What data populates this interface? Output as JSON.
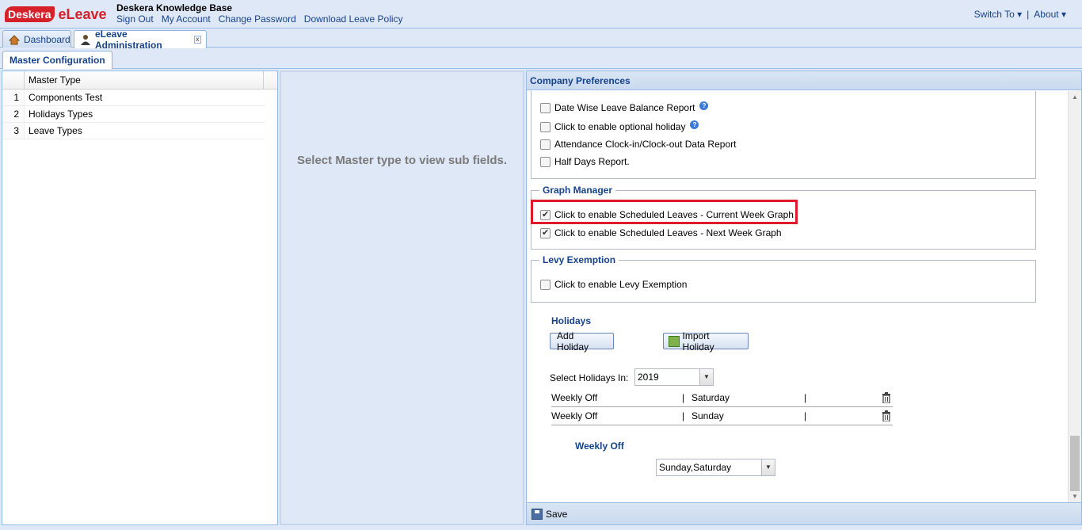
{
  "header": {
    "logo_badge": "Deskera",
    "logo_app": "eLeave",
    "site_title": "Desk​era Knowledge Base",
    "links": [
      "Sign Out",
      "My Account",
      "Change Password",
      "Download Leave Policy"
    ],
    "switch_to": "Switch To",
    "about": "About",
    "separator": "|"
  },
  "tabs": {
    "dashboard": "Dashboard",
    "admin": "eLeave Administration",
    "close": "x"
  },
  "subtab": {
    "label": "Master Configuration"
  },
  "grid": {
    "header": "Master Type",
    "rows": [
      {
        "num": "1",
        "label": "Components Test"
      },
      {
        "num": "2",
        "label": "Holidays Types"
      },
      {
        "num": "3",
        "label": "Leave Types"
      }
    ]
  },
  "middle": {
    "message": "Select Master type to view sub fields."
  },
  "company_prefs": {
    "title": "Company Preferences",
    "report_items": [
      {
        "label": "Date Wise Leave Balance Report",
        "checked": false,
        "help": true
      },
      {
        "label": "Click to enable optional holiday",
        "checked": false,
        "help": true
      },
      {
        "label": "Attendance Clock-in/Clock-out Data Report",
        "checked": false,
        "help": false
      },
      {
        "label": "Half Days Report.",
        "checked": false,
        "help": false
      }
    ],
    "graph_manager": {
      "legend": "Graph Manager",
      "current_week": "Click to enable Scheduled Leaves - Current Week Graph",
      "next_week": "Click to enable Scheduled Leaves - Next Week Graph"
    },
    "levy": {
      "legend": "Levy Exemption",
      "label": "Click to enable Levy Exemption"
    },
    "holidays": {
      "title": "Holidays",
      "add_button": "Add Holiday",
      "import_button": "Import Holiday",
      "select_label": "Select Holidays In:",
      "year": "2019",
      "rows": [
        {
          "type": "Weekly Off",
          "sep1": "|",
          "day": "Saturday",
          "sep2": "|"
        },
        {
          "type": "Weekly Off",
          "sep1": "|",
          "day": "Sunday",
          "sep2": "|"
        }
      ],
      "weekly_off_label": "Weekly Off",
      "weekly_off_value": "Sunday,Saturday"
    },
    "save_label": "Save"
  },
  "colors": {
    "accent": "#15428b",
    "highlight": "#e0192b",
    "brand": "#d6202a"
  }
}
